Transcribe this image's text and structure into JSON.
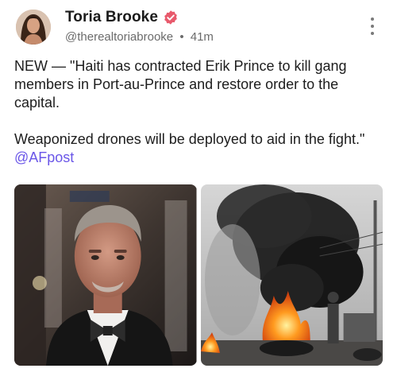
{
  "author": {
    "display_name": "Toria Brooke",
    "handle": "@therealtoriabrooke",
    "separator": "•",
    "time": "41m",
    "verified_icon": "verified-badge-icon",
    "avatar_icon": "avatar-photo"
  },
  "post": {
    "paragraph1": "NEW — \"Haiti has contracted Erik Prince to kill gang members in Port-au-Prince and restore order to the capital.",
    "paragraph2_text": "Weaponized drones will be deployed to aid in the fight.\" ",
    "mention": "@AFpost"
  },
  "media": {
    "image1_icon": "portrait-photo",
    "image2_icon": "burning-tires-photo"
  },
  "colors": {
    "accent": "#6a56e8",
    "verified": "#e85a6c",
    "muted": "#6b6b6b"
  }
}
